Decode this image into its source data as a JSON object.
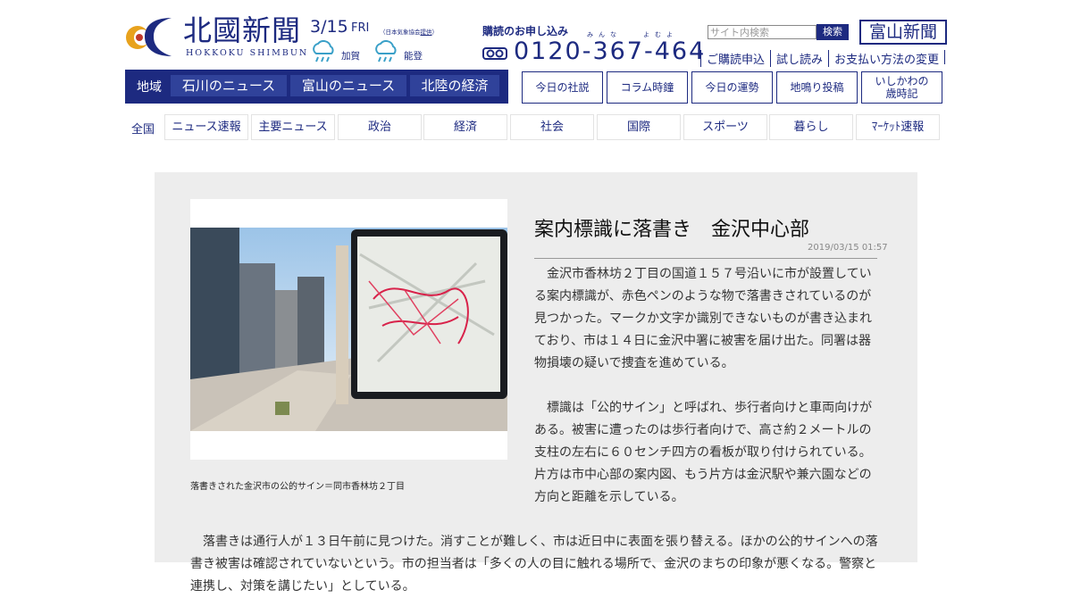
{
  "header": {
    "logo_main": "北國新聞",
    "logo_sub": "HOKKOKU SHIMBUN",
    "date": "3/15",
    "day_of_week": "FRI",
    "weather_note": "（日本気象協会",
    "weather_note_link": "提供",
    "weather_note_end": "）",
    "weather": [
      {
        "label": "加賀",
        "icon": "rain-icon"
      },
      {
        "label": "能登",
        "icon": "rain-icon"
      }
    ],
    "subscribe_title": "購読のお申し込み",
    "subscribe_ruby": [
      "みんな",
      "よむよ"
    ],
    "phone": "0120-367-464",
    "search_placeholder": "サイト内検索",
    "search_button": "検索",
    "toyama_button": "富山新聞",
    "links": [
      "ご購読申込",
      "試し読み",
      "お支払い方法の変更"
    ]
  },
  "region_nav": {
    "label": "地域",
    "tabs": [
      "石川のニュース",
      "富山のニュース",
      "北陸の経済"
    ]
  },
  "box_links": [
    "今日の社説",
    "コラム時鐘",
    "今日の運勢",
    "地鳴り投稿",
    "いしかわの\n歳時記"
  ],
  "category_nav": {
    "label": "全国",
    "items": [
      "ニュース速報",
      "主要ニュース",
      "政治",
      "経済",
      "社会",
      "国際",
      "スポーツ",
      "暮らし",
      "ﾏｰｹｯﾄ速報"
    ]
  },
  "article": {
    "headline": "案内標識に落書き　金沢中心部",
    "timestamp": "2019/03/15 01:57",
    "caption": "落書きされた金沢市の公的サイン＝同市香林坊２丁目",
    "paragraphs": [
      "　金沢市香林坊２丁目の国道１５７号沿いに市が設置している案内標識が、赤色ペンのような物で落書きされているのが見つかった。マークか文字か識別できないものが書き込まれており、市は１４日に金沢中署に被害を届け出た。同署は器物損壊の疑いで捜査を進めている。",
      "　標識は「公的サイン」と呼ばれ、歩行者向けと車両向けがある。被害に遭ったのは歩行者向けで、高さ約２メートルの支柱の左右に６０センチ四方の看板が取り付けられている。片方は市中心部の案内図、もう片方は金沢駅や兼六園などの方向と距離を示している。",
      "　落書きは通行人が１３日午前に見つけた。消すことが難しく、市は近日中に表面を張り替える。ほかの公的サインへの落書き被害は確認されていないという。市の担当者は「多くの人の目に触れる場所で、金沢のまちの印象が悪くなる。警察と連携し、対策を講じたい」としている。"
    ]
  },
  "colors": {
    "brand": "#1d2a80",
    "panel": "#ededed"
  }
}
